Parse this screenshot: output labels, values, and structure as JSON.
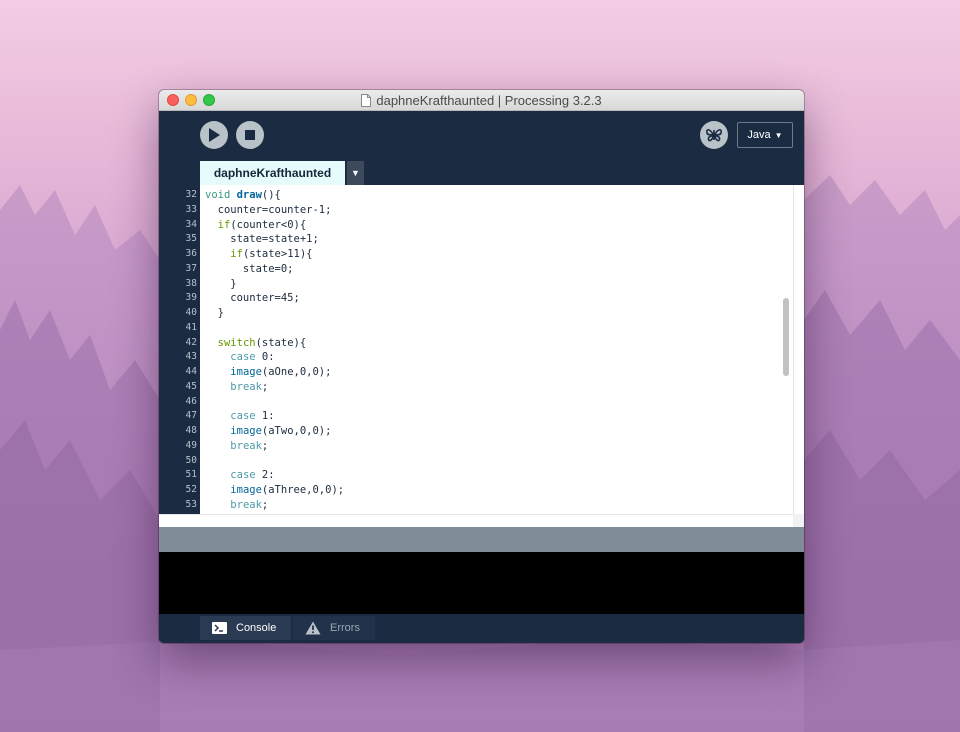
{
  "window": {
    "title": "daphneKrafthaunted | Processing 3.2.3"
  },
  "toolbar": {
    "run_icon": "play-icon",
    "stop_icon": "stop-icon",
    "debug_icon": "butterfly-icon",
    "mode_label": "Java",
    "mode_arrow": "▼"
  },
  "tabs": [
    {
      "label": "daphneKrafthaunted",
      "active": true
    }
  ],
  "tab_menu_arrow": "▼",
  "editor": {
    "line_numbers": [
      "32",
      "33",
      "34",
      "35",
      "36",
      "37",
      "38",
      "39",
      "40",
      "41",
      "42",
      "43",
      "44",
      "45",
      "46",
      "47",
      "48",
      "49",
      "50",
      "51",
      "52",
      "53"
    ],
    "lines": [
      [
        {
          "t": "void ",
          "c": "kw-void"
        },
        {
          "t": "draw",
          "c": "kw-draw"
        },
        {
          "t": "(){",
          "c": ""
        }
      ],
      [
        {
          "t": "  counter=counter-1;",
          "c": ""
        }
      ],
      [
        {
          "t": "  ",
          "c": ""
        },
        {
          "t": "if",
          "c": "kw-ctrl"
        },
        {
          "t": "(counter<0){",
          "c": ""
        }
      ],
      [
        {
          "t": "    state=state+1;",
          "c": ""
        }
      ],
      [
        {
          "t": "    ",
          "c": ""
        },
        {
          "t": "if",
          "c": "kw-ctrl"
        },
        {
          "t": "(state>11){",
          "c": ""
        }
      ],
      [
        {
          "t": "      state=0;",
          "c": ""
        }
      ],
      [
        {
          "t": "    }",
          "c": ""
        }
      ],
      [
        {
          "t": "    counter=45;",
          "c": ""
        }
      ],
      [
        {
          "t": "  }",
          "c": ""
        }
      ],
      [
        {
          "t": "",
          "c": ""
        }
      ],
      [
        {
          "t": "  ",
          "c": ""
        },
        {
          "t": "switch",
          "c": "kw-ctrl"
        },
        {
          "t": "(state){",
          "c": ""
        }
      ],
      [
        {
          "t": "    ",
          "c": ""
        },
        {
          "t": "case",
          "c": "kw-case"
        },
        {
          "t": " 0:",
          "c": ""
        }
      ],
      [
        {
          "t": "    ",
          "c": ""
        },
        {
          "t": "image",
          "c": "kw-fn"
        },
        {
          "t": "(aOne,0,0);",
          "c": ""
        }
      ],
      [
        {
          "t": "    ",
          "c": ""
        },
        {
          "t": "break",
          "c": "kw-case"
        },
        {
          "t": ";",
          "c": ""
        }
      ],
      [
        {
          "t": "",
          "c": ""
        }
      ],
      [
        {
          "t": "    ",
          "c": ""
        },
        {
          "t": "case",
          "c": "kw-case"
        },
        {
          "t": " 1:",
          "c": ""
        }
      ],
      [
        {
          "t": "    ",
          "c": ""
        },
        {
          "t": "image",
          "c": "kw-fn"
        },
        {
          "t": "(aTwo,0,0);",
          "c": ""
        }
      ],
      [
        {
          "t": "    ",
          "c": ""
        },
        {
          "t": "break",
          "c": "kw-case"
        },
        {
          "t": ";",
          "c": ""
        }
      ],
      [
        {
          "t": "",
          "c": ""
        }
      ],
      [
        {
          "t": "    ",
          "c": ""
        },
        {
          "t": "case",
          "c": "kw-case"
        },
        {
          "t": " 2:",
          "c": ""
        }
      ],
      [
        {
          "t": "    ",
          "c": ""
        },
        {
          "t": "image",
          "c": "kw-fn"
        },
        {
          "t": "(aThree,0,0);",
          "c": ""
        }
      ],
      [
        {
          "t": "    ",
          "c": ""
        },
        {
          "t": "break",
          "c": "kw-case"
        },
        {
          "t": ";",
          "c": ""
        }
      ]
    ]
  },
  "bottom_tabs": {
    "console_label": "Console",
    "console_icon": "terminal-icon",
    "errors_label": "Errors",
    "errors_icon": "warning-icon"
  },
  "colors": {
    "window_bg": "#1b2b42",
    "tab_active_bg": "#e6fcfc",
    "keyword_blue": "#006699",
    "keyword_green": "#669900",
    "keyword_teal": "#33997e"
  }
}
